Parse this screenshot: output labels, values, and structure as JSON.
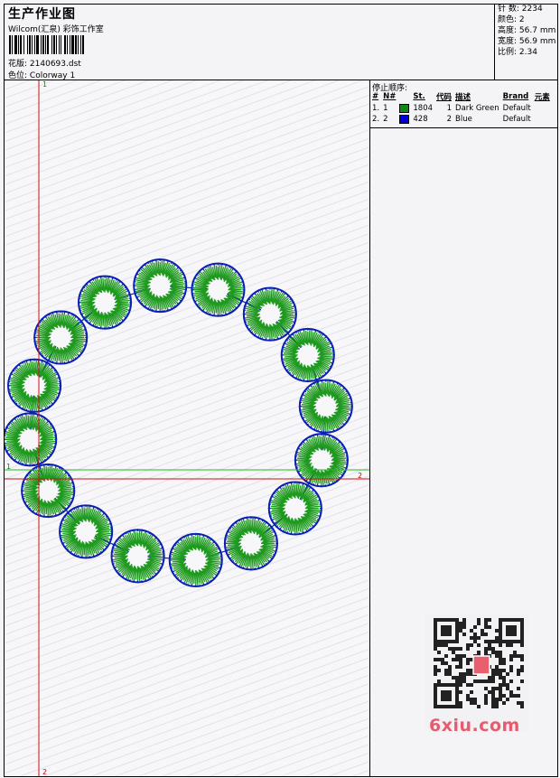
{
  "header": {
    "title": "生产作业图",
    "subtitle": "Wilcom(汇泉)  彩饰工作室",
    "design_label": "花版:",
    "design_value": "2140693.dst",
    "colorway_label": "色位:",
    "colorway_value": "Colorway 1"
  },
  "stats": [
    {
      "label": "针 数:",
      "value": "2234"
    },
    {
      "label": "颜色:",
      "value": "2"
    },
    {
      "label": "高度:",
      "value": "56.7 mm"
    },
    {
      "label": "宽度:",
      "value": "56.9 mm"
    },
    {
      "label": "比例:",
      "value": "2.34"
    }
  ],
  "stop_sequence": {
    "title": "停止顺序:",
    "columns": [
      "#",
      "N#",
      "St.",
      "代码",
      "描述",
      "Brand",
      "元素"
    ],
    "rows": [
      {
        "num": "1.",
        "n": "1",
        "color": "#0e8a0e",
        "stitches": "1804",
        "code": "1",
        "desc": "Dark Green",
        "brand": "Default"
      },
      {
        "num": "2.",
        "n": "2",
        "color": "#0000dd",
        "stitches": "428",
        "code": "2",
        "desc": "Blue",
        "brand": "Default"
      }
    ]
  },
  "axis_labels": {
    "green_v": "1",
    "green_h": "1",
    "red_h": "2",
    "red_v": "2"
  },
  "watermark": "6xiu.com",
  "colors": {
    "green": "#1e9a1e",
    "blue": "#0a1fb4",
    "red_axis": "#d01010",
    "green_axis": "#22bb22"
  },
  "design": {
    "motif_count": 16,
    "shape": "ring-of-satin-circles"
  }
}
